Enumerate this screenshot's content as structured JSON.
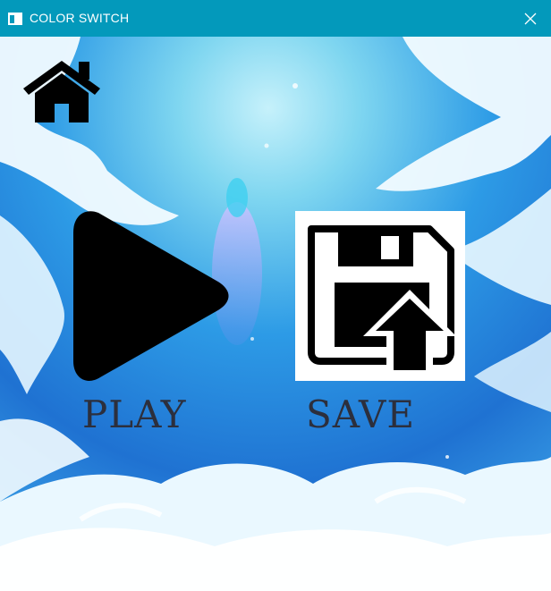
{
  "window": {
    "title": "COLOR SWITCH",
    "title_bar_color": "#0399bb",
    "icons": {
      "app": "window-app-icon",
      "close": "close-icon"
    }
  },
  "menu": {
    "home_icon": "home-icon",
    "play": {
      "icon": "play-icon",
      "label": "PLAY"
    },
    "save": {
      "icon": "save-upload-icon",
      "label": "SAVE"
    }
  },
  "colors": {
    "sky_top": "#7fd6f0",
    "sky_mid": "#2d9be6",
    "sky_deep": "#1f72d2",
    "cloud": "#f2fbff",
    "label_text": "#2c2f3d",
    "icon": "#000000"
  }
}
